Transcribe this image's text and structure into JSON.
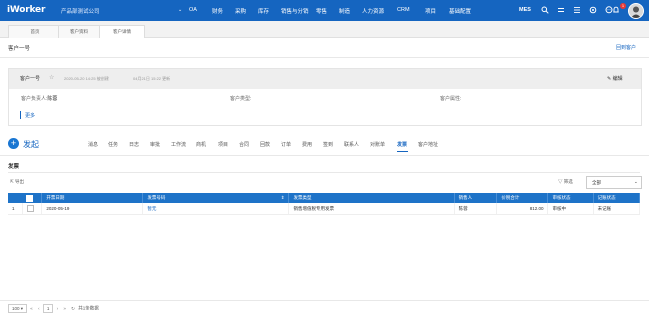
{
  "topbar": {
    "logo": "iWorker",
    "company": "产品部测试公司",
    "caret": "⌄",
    "nav": [
      "OA",
      "财务",
      "采购",
      "库存",
      "销售与分销",
      "零售",
      "制造",
      "人力资源",
      "CRM",
      "项目",
      "基础配置"
    ],
    "mes": "MES",
    "badge_count": "1"
  },
  "tabs": [
    "首页",
    "客户资料",
    "客户详情"
  ],
  "page": {
    "title": "客户一号",
    "back_link": "回到客户"
  },
  "customer": {
    "name": "客户一号",
    "created": "2020-05-20 14:25 被创建",
    "updated": "04月21日 15:22 更新",
    "edit": "编辑",
    "fields": [
      {
        "label": "客户负责人:",
        "value": "陈蓉"
      },
      {
        "label": "客户类型:",
        "value": ""
      },
      {
        "label": "客户属性:",
        "value": ""
      }
    ],
    "more": "更多"
  },
  "actions": {
    "fab": "+",
    "fab_label": "发起",
    "subtabs": [
      "消息",
      "任务",
      "日志",
      "审批",
      "工作流",
      "商机",
      "项目",
      "合同",
      "回款",
      "订单",
      "费用",
      "签到",
      "联系人",
      "对账单",
      "发票",
      "客户地址"
    ],
    "active_subtab": "发票"
  },
  "invoice": {
    "section_title": "发票",
    "export": "导出",
    "filter": "筛选",
    "select_value": "全部",
    "columns": [
      "开票日期",
      "发票号码",
      "发票类型",
      "销售人",
      "价税合计",
      "审核状态",
      "记账状态"
    ],
    "rows": [
      {
        "index": "1",
        "date": "2020-05-19",
        "number": "暂无",
        "type": "销售增值税专用发票",
        "seller": "陈蓉",
        "total": "812.00",
        "audit": "审核中",
        "booking": "未记账"
      }
    ]
  },
  "pager": {
    "page_size": "100",
    "current_page": "1",
    "summary": "共1条数据"
  }
}
